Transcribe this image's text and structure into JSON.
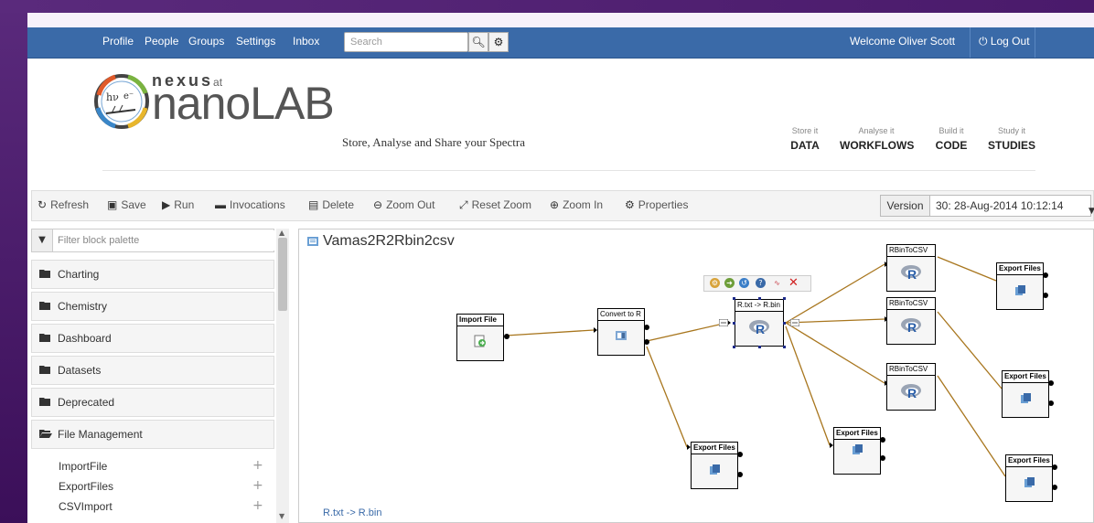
{
  "navbar": {
    "links": [
      "Profile",
      "People",
      "Groups",
      "Settings",
      "Inbox"
    ],
    "search_placeholder": "Search",
    "search_icon": "search-icon",
    "settings_icon": "gear-icon",
    "welcome": "Welcome Oliver Scott",
    "logout": "Log Out",
    "color": "#3a6aa8"
  },
  "header": {
    "logo_nexus": "nexus",
    "logo_at": "at",
    "logo_nano": "nanoLAB",
    "tagline": "Store, Analyse and Share your Spectra",
    "sections": [
      {
        "small": "Store it",
        "big": "DATA"
      },
      {
        "small": "Analyse it",
        "big": "WORKFLOWS"
      },
      {
        "small": "Build it",
        "big": "CODE"
      },
      {
        "small": "Study it",
        "big": "STUDIES"
      }
    ]
  },
  "toolbar": {
    "items": [
      {
        "icon": "refresh-icon",
        "label": "Refresh"
      },
      {
        "icon": "save-icon",
        "label": "Save"
      },
      {
        "icon": "play-icon",
        "label": "Run"
      },
      {
        "icon": "folder-icon",
        "label": "Invocations"
      },
      {
        "icon": "trash-icon",
        "label": "Delete"
      },
      {
        "icon": "zoom-out-icon",
        "label": "Zoom Out"
      },
      {
        "icon": "reset-zoom-icon",
        "label": "Reset Zoom"
      },
      {
        "icon": "zoom-in-icon",
        "label": "Zoom In"
      },
      {
        "icon": "gear-icon",
        "label": "Properties"
      }
    ],
    "version_label": "Version",
    "version_value": "30: 28-Aug-2014 10:12:14"
  },
  "palette": {
    "filter_placeholder": "Filter block palette",
    "categories": [
      "Charting",
      "Chemistry",
      "Dashboard",
      "Datasets",
      "Deprecated",
      "File Management"
    ],
    "file_management_items": [
      "ImportFile",
      "ExportFiles",
      "CSVImport"
    ]
  },
  "canvas": {
    "title": "Vamas2R2Rbin2csv",
    "status": "R.txt -> R.bin",
    "blocks": [
      {
        "id": "import",
        "title": "Import File",
        "icon": "import-file-icon"
      },
      {
        "id": "convert",
        "title": "Convert to R",
        "icon": "convert-icon"
      },
      {
        "id": "rtxt",
        "title": "R.txt -> R.bin",
        "icon": "r-logo-icon"
      },
      {
        "id": "rbin1",
        "title": "RBinToCSV",
        "icon": "r-logo-icon"
      },
      {
        "id": "rbin2",
        "title": "RBinToCSV",
        "icon": "r-logo-icon"
      },
      {
        "id": "rbin3",
        "title": "RBinToCSV",
        "icon": "r-logo-icon"
      },
      {
        "id": "export1",
        "title": "Export Files",
        "icon": "export-file-icon"
      },
      {
        "id": "export2",
        "title": "Export Files",
        "icon": "export-file-icon"
      },
      {
        "id": "export3",
        "title": "Export Files",
        "icon": "export-file-icon"
      },
      {
        "id": "export4",
        "title": "Export Files",
        "icon": "export-file-icon"
      },
      {
        "id": "export5",
        "title": "Export Files",
        "icon": "export-file-icon"
      }
    ],
    "selection_tools": [
      "configure-icon",
      "forward-icon",
      "history-icon",
      "help-icon",
      "chart-icon",
      "delete-icon"
    ],
    "edge_color": "#a8761e"
  }
}
